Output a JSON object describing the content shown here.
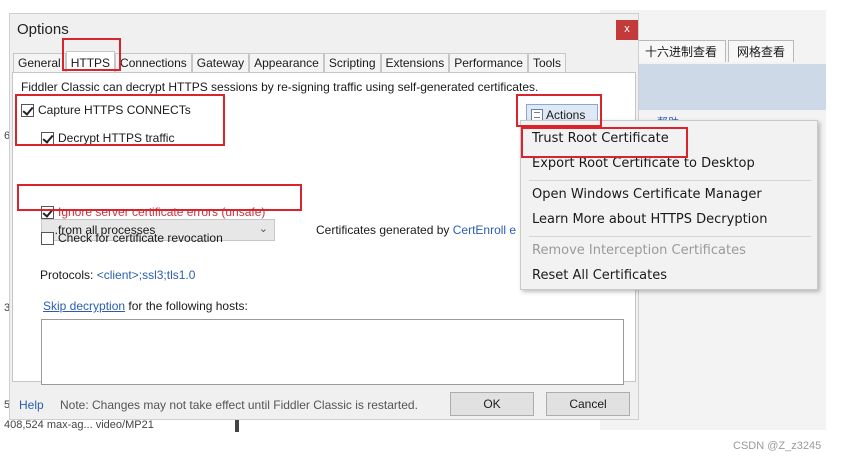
{
  "background_window": {
    "tabs": [
      "十六进制查看",
      "网格查看"
    ],
    "help_fragment": "帮助",
    "bottom_fragment": "408,524   max-ag...   video/MP21",
    "left_fragments": [
      "6",
      "3",
      "5"
    ]
  },
  "dialog": {
    "title": "Options",
    "close_glyph": "x",
    "tabs": [
      "General",
      "HTTPS",
      "Connections",
      "Gateway",
      "Appearance",
      "Scripting",
      "Extensions",
      "Performance",
      "Tools"
    ],
    "active_tab": "HTTPS",
    "description": "Fiddler Classic can decrypt HTTPS sessions by re-signing traffic using self-generated certificates.",
    "capture_https": {
      "label": "Capture HTTPS CONNECTs",
      "checked": true
    },
    "decrypt_https": {
      "label": "Decrypt HTTPS traffic",
      "checked": true
    },
    "process_select": {
      "value": "...from all processes",
      "caret": "⌄"
    },
    "certs_generated_label": "Certificates generated by",
    "certs_generated_value": "CertEnroll e",
    "ignore_errors": {
      "label": "Ignore server certificate errors (unsafe)",
      "checked": true
    },
    "check_revocation": {
      "label": "Check for certificate revocation",
      "checked": false
    },
    "protocols_label": "Protocols:",
    "protocols_value": "<client>;ssl3;tls1.0",
    "skip_link": "Skip decryption",
    "skip_suffix": " for the following hosts:",
    "hosts_value": "",
    "actions_label": "Actions",
    "help": "Help",
    "note": "Note: Changes may not take effect until Fiddler Classic is restarted.",
    "ok": "OK",
    "cancel": "Cancel"
  },
  "actions_menu": {
    "items": [
      {
        "label": "Trust Root Certificate",
        "disabled": false
      },
      {
        "label": "Export Root Certificate to Desktop",
        "disabled": false
      },
      {
        "label": "Open Windows Certificate Manager",
        "disabled": false
      },
      {
        "label": "Learn More about HTTPS Decryption",
        "disabled": false
      },
      {
        "label": "Remove Interception Certificates",
        "disabled": true
      },
      {
        "label": "Reset All Certificates",
        "disabled": false
      }
    ]
  },
  "watermark": "CSDN @Z_z3245",
  "colors": {
    "highlight": "#d9232d",
    "link": "#2a5db0",
    "unsafe_text": "#c8323c",
    "close_button": "#c23a3a"
  }
}
